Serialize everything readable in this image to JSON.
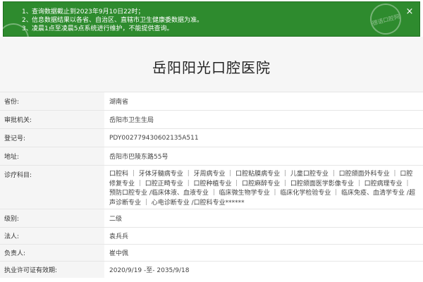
{
  "notice": {
    "items": [
      {
        "num": "1、",
        "text": "查询数据截止到2023年9月10日22时；"
      },
      {
        "num": "2、",
        "text": "信息数据结果以各省、自治区、直辖市卫生健康委数据为准。"
      },
      {
        "num": "3、",
        "text": "凌晨1点至凌晨5点系统进行维护，不能提供查询。"
      }
    ],
    "close_label": "×",
    "watermark": "德语口腔网",
    "bg_color": "#2e8b2e"
  },
  "title": "岳阳阳光口腔医院",
  "fields": [
    {
      "label": "省份:",
      "value": "湖南省"
    },
    {
      "label": "审批机关:",
      "value": "岳阳市卫生生局"
    },
    {
      "label": "登记号:",
      "value": "PDY002779430602135A511"
    },
    {
      "label": "地址:",
      "value": "岳阳市巴陵东路55号"
    },
    {
      "label": "诊疗科目:",
      "value": "口腔科 ｜ 牙体牙髓病专业 ｜ 牙周病专业 ｜ 口腔粘膜病专业 ｜ 儿童口腔专业 ｜ 口腔颌面外科专业 ｜ 口腔修复专业 ｜ 口腔正畸专业 ｜ 口腔种植专业 ｜ 口腔麻醉专业 ｜ 口腔颌面医学影像专业 ｜ 口腔病理专业 ｜ 预防口腔专业 /临床体液、血液专业 ｜ 临床微生物学专业 ｜ 临床化学检验专业 ｜ 临床免疫、血清学专业 /超声诊断专业 ｜ 心电诊断专业 /口腔科专业******"
    },
    {
      "label": "级别:",
      "value": "二级"
    },
    {
      "label": "法人:",
      "value": "袁兵兵"
    },
    {
      "label": "负责人:",
      "value": "崔中佩"
    },
    {
      "label": "执业许可证有效期:",
      "value": "2020/9/19 -至- 2035/9/18"
    }
  ]
}
